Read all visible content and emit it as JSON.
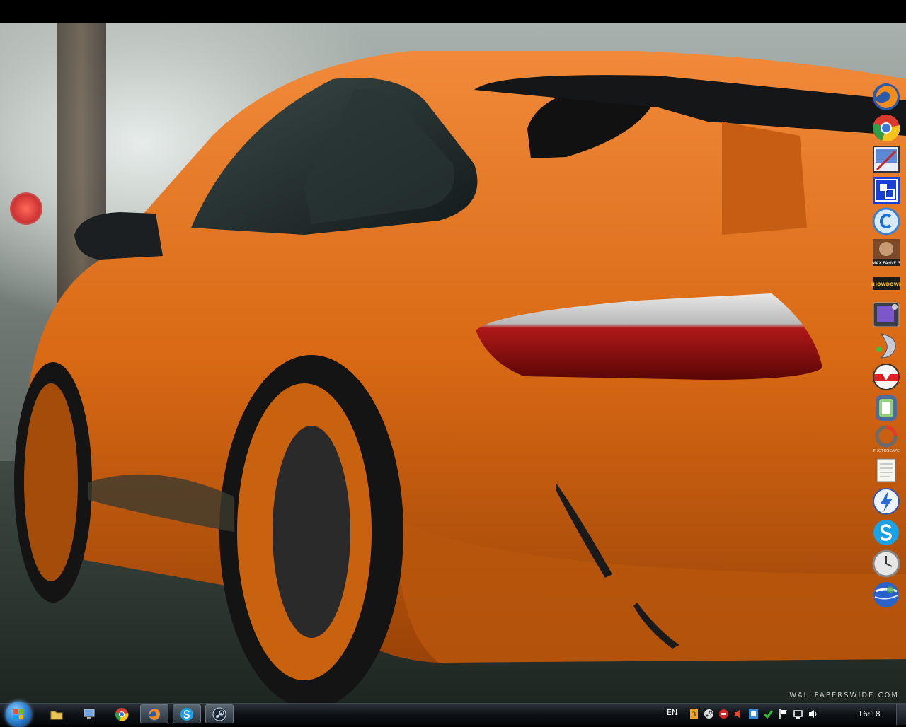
{
  "wallpaper": {
    "watermark": "WALLPAPERSWIDE.COM"
  },
  "dock": {
    "icons": [
      {
        "name": "firefox-icon"
      },
      {
        "name": "chrome-icon"
      },
      {
        "name": "paint-tool-icon"
      },
      {
        "name": "window-manager-icon"
      },
      {
        "name": "ccleaner-icon"
      },
      {
        "name": "max-payne-3-icon",
        "label": "MAX PAYNE 3"
      },
      {
        "name": "dirt-showdown-icon",
        "label": "SHOWDOWN"
      },
      {
        "name": "media-player-icon"
      },
      {
        "name": "speaker-app-icon"
      },
      {
        "name": "download-manager-icon"
      },
      {
        "name": "phone-sync-icon"
      },
      {
        "name": "photoscape-icon",
        "label": "PHOTOSCAPE"
      },
      {
        "name": "notepad-icon"
      },
      {
        "name": "lightning-app-icon"
      },
      {
        "name": "skype-icon"
      },
      {
        "name": "clock-icon"
      },
      {
        "name": "google-earth-icon"
      }
    ]
  },
  "taskbar": {
    "buttons": [
      {
        "name": "explorer-icon",
        "active": false
      },
      {
        "name": "computer-icon",
        "active": false
      },
      {
        "name": "chrome-icon",
        "active": false
      },
      {
        "name": "firefox-icon",
        "active": true
      },
      {
        "name": "skype-icon",
        "active": true
      },
      {
        "name": "steam-icon",
        "active": true
      }
    ],
    "language": "EN",
    "clock": "16:18"
  }
}
